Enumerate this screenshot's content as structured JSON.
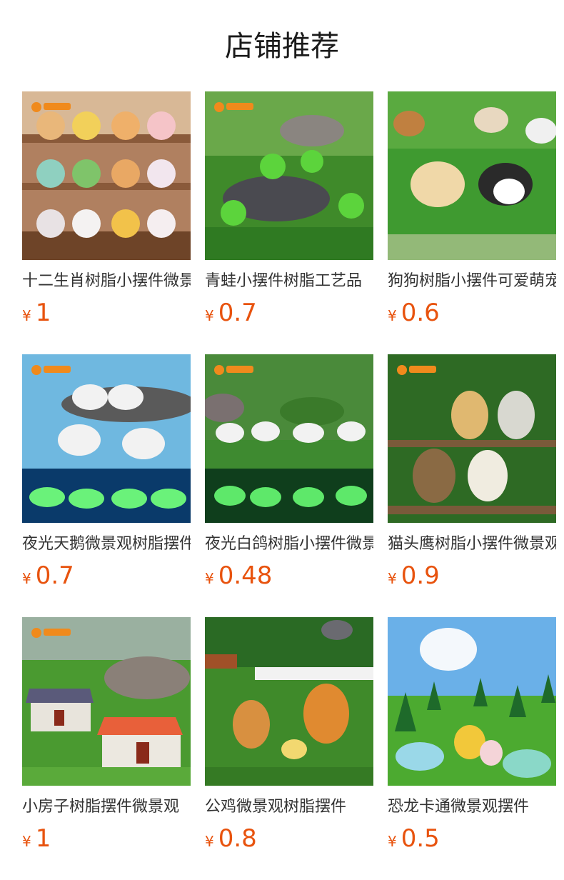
{
  "page_title": "店铺推荐",
  "currency_symbol": "¥",
  "colors": {
    "price": "#e8530e",
    "title": "#1a1a1a",
    "name": "#333333"
  },
  "products": [
    {
      "name": "十二生肖树脂小摆件微景观",
      "price": "1",
      "image_icon": "zodiac-figurines-image"
    },
    {
      "name": "青蛙小摆件树脂工艺品",
      "price": "0.7",
      "image_icon": "frog-figurines-image"
    },
    {
      "name": "狗狗树脂小摆件可爱萌宠",
      "price": "0.6",
      "image_icon": "dog-figurines-image"
    },
    {
      "name": "夜光天鹅微景观树脂摆件",
      "price": "0.7",
      "image_icon": "swan-figurines-image"
    },
    {
      "name": "夜光白鸽树脂小摆件微景观",
      "price": "0.48",
      "image_icon": "dove-figurines-image"
    },
    {
      "name": "猫头鹰树脂小摆件微景观",
      "price": "0.9",
      "image_icon": "owl-figurines-image"
    },
    {
      "name": "小房子树脂摆件微景观",
      "price": "1",
      "image_icon": "house-figurines-image"
    },
    {
      "name": "公鸡微景观树脂摆件",
      "price": "0.8",
      "image_icon": "rooster-figurines-image"
    },
    {
      "name": "恐龙卡通微景观摆件",
      "price": "0.5",
      "image_icon": "dinosaur-figurines-image"
    }
  ]
}
